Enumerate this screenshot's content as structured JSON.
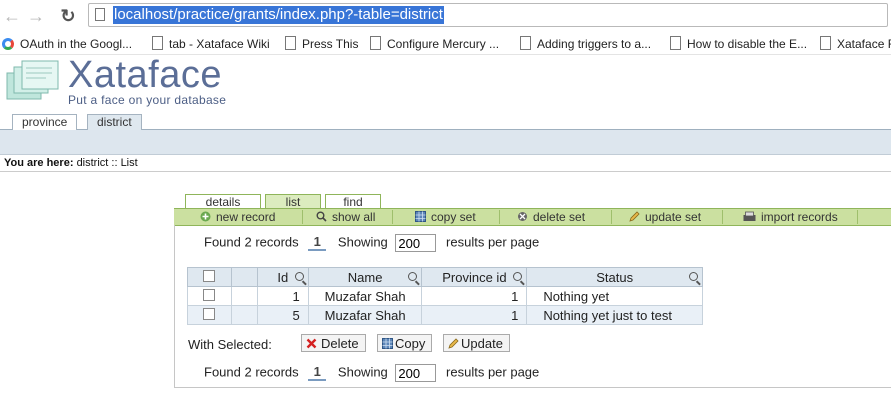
{
  "browser": {
    "url": "localhost/practice/grants/index.php?-table=district",
    "bookmarks": [
      "OAuth in the Googl...",
      "tab - Xataface Wiki",
      "Press This",
      "Configure Mercury ...",
      "Adding triggers to a...",
      "How to disable the E...",
      "Xataface F"
    ]
  },
  "header": {
    "logo_title": "Xataface",
    "logo_tagline": "Put a face on your database"
  },
  "table_tabs": [
    "province",
    "district"
  ],
  "breadcrumb": {
    "prefix": "You are here:",
    "path": "district :: List"
  },
  "action_tabs": [
    "details",
    "list",
    "find"
  ],
  "actions": {
    "new_record": "new record",
    "show_all": "show all",
    "copy_set": "copy set",
    "delete_set": "delete set",
    "update_set": "update set",
    "import_records": "import records"
  },
  "pagination": {
    "found_text": "Found 2 records",
    "page": "1",
    "showing_label": "Showing",
    "per_page_value": "200",
    "per_page_suffix": "results per page"
  },
  "table": {
    "columns": [
      "Id",
      "Name",
      "Province id",
      "Status"
    ],
    "rows": [
      {
        "id": "1",
        "name": "Muzafar Shah",
        "province_id": "1",
        "status": "Nothing yet"
      },
      {
        "id": "5",
        "name": "Muzafar Shah",
        "province_id": "1",
        "status": "Nothing yet just to test"
      }
    ]
  },
  "with_selected": {
    "label": "With Selected:",
    "delete": "Delete",
    "copy": "Copy",
    "update": "Update"
  },
  "colors": {
    "accent_green": "#cbe0a0",
    "header_blue": "#dde6ee",
    "logo_blue": "#5b6e97",
    "selection_blue": "#3875d7"
  }
}
